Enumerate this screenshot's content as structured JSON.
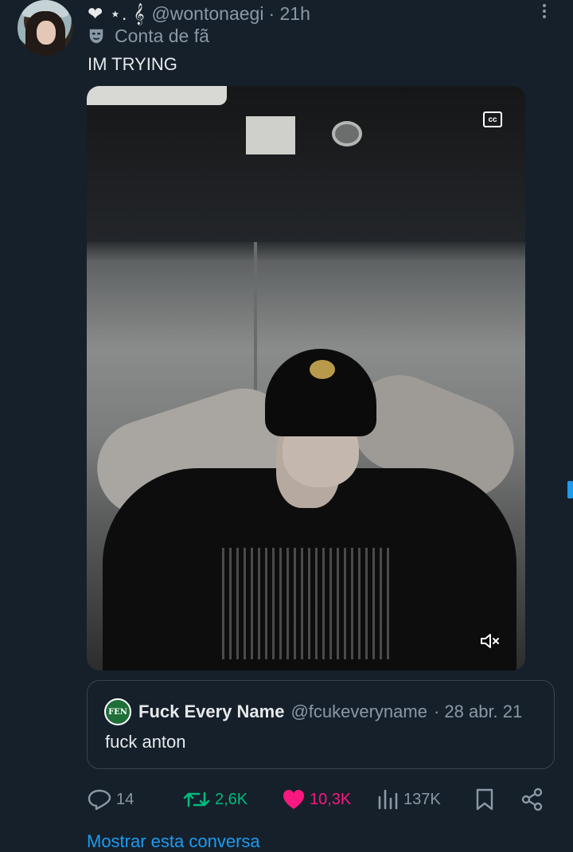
{
  "tweet": {
    "display_decoration": "❤︎ ⋆. 𝄞",
    "handle": "@wontonaegi",
    "time": "· 21h",
    "account_label": "Conta de fã",
    "text": "IM TRYING",
    "media": {
      "cc_label": "cc"
    }
  },
  "quoted": {
    "avatar_text": "FEN",
    "name": "Fuck Every Name",
    "handle": "@fcukeveryname",
    "date": "· 28 abr. 21",
    "text": "fuck anton"
  },
  "actions": {
    "replies": "14",
    "retweets": "2,6K",
    "likes": "10,3K",
    "views": "137K"
  },
  "show_conversation": "Mostrar esta conversa",
  "colors": {
    "background": "#15202b",
    "accent": "#1d9bf0",
    "retweet": "#00ba7c",
    "like": "#f91880",
    "muted_text": "#8b98a5"
  }
}
